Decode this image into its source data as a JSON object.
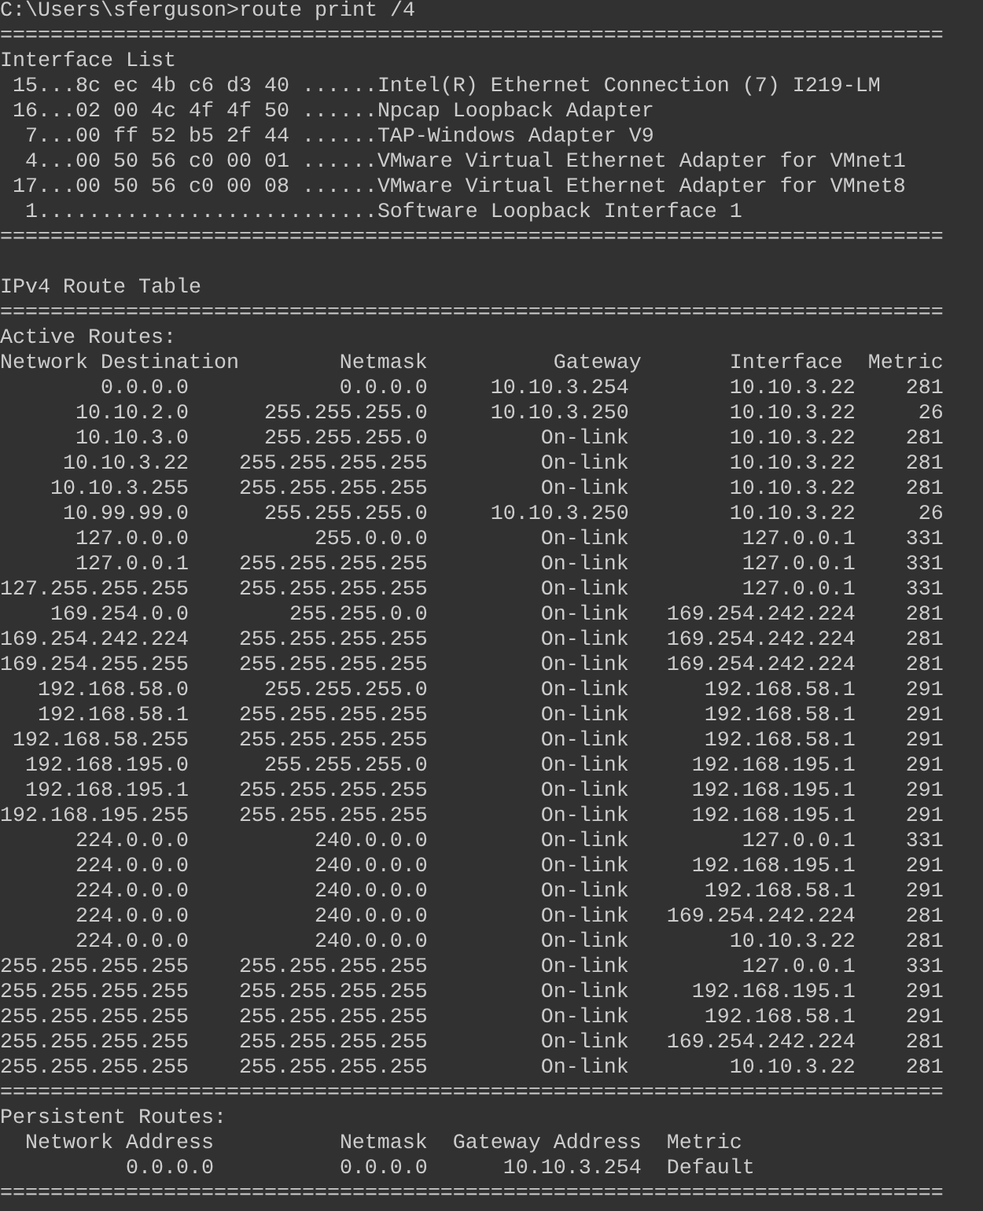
{
  "command": "C:\\Users\\sferguson>route print /4",
  "interface_list": {
    "separator_top": "===========================================================================",
    "title": "Interface List",
    "interfaces": [
      {
        "index": "15",
        "address": "...8c ec 4b c6 d3 40 ......",
        "name": "Intel(R) Ethernet Connection (7) I219-LM"
      },
      {
        "index": "16",
        "address": "...02 00 4c 4f 4f 50 ......",
        "name": "Npcap Loopback Adapter"
      },
      {
        "index": "7",
        "address": "...00 ff 52 b5 2f 44 ......",
        "name": "TAP-Windows Adapter V9"
      },
      {
        "index": "4",
        "address": "...00 50 56 c0 00 01 ......",
        "name": "VMware Virtual Ethernet Adapter for VMnet1"
      },
      {
        "index": "17",
        "address": "...00 50 56 c0 00 08 ......",
        "name": "VMware Virtual Ethernet Adapter for VMnet8"
      },
      {
        "index": "1",
        "address": "...........................",
        "name": "Software Loopback Interface 1"
      }
    ],
    "separator_bottom": "==========================================================================="
  },
  "ipv4_route_table": {
    "title": "IPv4 Route Table",
    "separator": "===========================================================================",
    "active_routes": {
      "title": "Active Routes:",
      "columns": [
        "Network Destination",
        "Netmask",
        "Gateway",
        "Interface",
        "Metric"
      ],
      "rows": [
        [
          "0.0.0.0",
          "0.0.0.0",
          "10.10.3.254",
          "10.10.3.22",
          "281"
        ],
        [
          "10.10.2.0",
          "255.255.255.0",
          "10.10.3.250",
          "10.10.3.22",
          "26"
        ],
        [
          "10.10.3.0",
          "255.255.255.0",
          "On-link",
          "10.10.3.22",
          "281"
        ],
        [
          "10.10.3.22",
          "255.255.255.255",
          "On-link",
          "10.10.3.22",
          "281"
        ],
        [
          "10.10.3.255",
          "255.255.255.255",
          "On-link",
          "10.10.3.22",
          "281"
        ],
        [
          "10.99.99.0",
          "255.255.255.0",
          "10.10.3.250",
          "10.10.3.22",
          "26"
        ],
        [
          "127.0.0.0",
          "255.0.0.0",
          "On-link",
          "127.0.0.1",
          "331"
        ],
        [
          "127.0.0.1",
          "255.255.255.255",
          "On-link",
          "127.0.0.1",
          "331"
        ],
        [
          "127.255.255.255",
          "255.255.255.255",
          "On-link",
          "127.0.0.1",
          "331"
        ],
        [
          "169.254.0.0",
          "255.255.0.0",
          "On-link",
          "169.254.242.224",
          "281"
        ],
        [
          "169.254.242.224",
          "255.255.255.255",
          "On-link",
          "169.254.242.224",
          "281"
        ],
        [
          "169.254.255.255",
          "255.255.255.255",
          "On-link",
          "169.254.242.224",
          "281"
        ],
        [
          "192.168.58.0",
          "255.255.255.0",
          "On-link",
          "192.168.58.1",
          "291"
        ],
        [
          "192.168.58.1",
          "255.255.255.255",
          "On-link",
          "192.168.58.1",
          "291"
        ],
        [
          "192.168.58.255",
          "255.255.255.255",
          "On-link",
          "192.168.58.1",
          "291"
        ],
        [
          "192.168.195.0",
          "255.255.255.0",
          "On-link",
          "192.168.195.1",
          "291"
        ],
        [
          "192.168.195.1",
          "255.255.255.255",
          "On-link",
          "192.168.195.1",
          "291"
        ],
        [
          "192.168.195.255",
          "255.255.255.255",
          "On-link",
          "192.168.195.1",
          "291"
        ],
        [
          "224.0.0.0",
          "240.0.0.0",
          "On-link",
          "127.0.0.1",
          "331"
        ],
        [
          "224.0.0.0",
          "240.0.0.0",
          "On-link",
          "192.168.195.1",
          "291"
        ],
        [
          "224.0.0.0",
          "240.0.0.0",
          "On-link",
          "192.168.58.1",
          "291"
        ],
        [
          "224.0.0.0",
          "240.0.0.0",
          "On-link",
          "169.254.242.224",
          "281"
        ],
        [
          "224.0.0.0",
          "240.0.0.0",
          "On-link",
          "10.10.3.22",
          "281"
        ],
        [
          "255.255.255.255",
          "255.255.255.255",
          "On-link",
          "127.0.0.1",
          "331"
        ],
        [
          "255.255.255.255",
          "255.255.255.255",
          "On-link",
          "192.168.195.1",
          "291"
        ],
        [
          "255.255.255.255",
          "255.255.255.255",
          "On-link",
          "192.168.58.1",
          "291"
        ],
        [
          "255.255.255.255",
          "255.255.255.255",
          "On-link",
          "169.254.242.224",
          "281"
        ],
        [
          "255.255.255.255",
          "255.255.255.255",
          "On-link",
          "10.10.3.22",
          "281"
        ]
      ],
      "separator_bottom": "==========================================================================="
    }
  },
  "persistent_routes": {
    "title": "Persistent Routes:",
    "columns": [
      "Network Address",
      "Netmask",
      "Gateway Address",
      "Metric"
    ],
    "rows": [
      [
        "0.0.0.0",
        "0.0.0.0",
        "10.10.3.254",
        "Default"
      ]
    ],
    "separator_bottom": "==========================================================================="
  }
}
